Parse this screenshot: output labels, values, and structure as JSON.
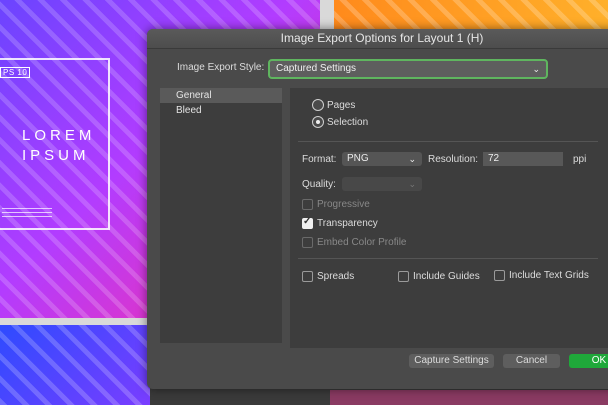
{
  "background": {
    "ps_tag": "PS 10",
    "lorem_line1": "LOREM",
    "lorem_line2": "IPSUM"
  },
  "dialog": {
    "title": "Image Export Options for Layout 1 (H)",
    "style_label": "Image Export Style:",
    "style_value": "Captured Settings",
    "sidebar": [
      "General",
      "Bleed"
    ],
    "radio_pages": "Pages",
    "radio_selection": "Selection",
    "format_label": "Format:",
    "format_value": "PNG",
    "resolution_label": "Resolution:",
    "resolution_value": "72",
    "resolution_unit": "ppi",
    "quality_label": "Quality:",
    "quality_value": "",
    "progressive": "Progressive",
    "transparency": "Transparency",
    "embed_color": "Embed Color Profile",
    "spreads": "Spreads",
    "include_guides": "Include Guides",
    "include_text_grids": "Include Text Grids",
    "capture_button": "Capture Settings",
    "cancel_button": "Cancel",
    "ok_button": "OK"
  },
  "colors": {
    "accent_green": "#1fa83a",
    "focus_ring": "#5fb55f"
  }
}
